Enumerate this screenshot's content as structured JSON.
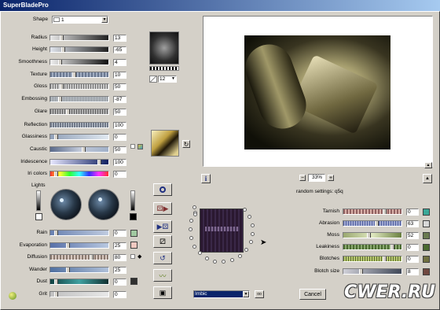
{
  "app": {
    "title": "SuperBladePro"
  },
  "shape": {
    "label": "Shape",
    "value": "1"
  },
  "left_sliders": [
    {
      "label": "Radius",
      "value": "13",
      "fill": "linear-gradient(90deg,#e8e8e8,#202020)"
    },
    {
      "label": "Height",
      "value": "-65",
      "fill": "linear-gradient(90deg,#e0e4ec,#202020)"
    },
    {
      "label": "Smoothness",
      "value": "4",
      "fill": "linear-gradient(90deg,#f0f0f0,#101010)"
    },
    {
      "label": "Texture",
      "value": "10",
      "fill": "repeating-linear-gradient(90deg,#6a7890 0 2px,#a0acc0 2px 4px)"
    },
    {
      "label": "Gloss",
      "value": "50",
      "fill": "repeating-linear-gradient(90deg,#707070 0 1px,#c8c8c8 1px 3px)"
    },
    {
      "label": "Embossing",
      "value": "-87",
      "fill": "repeating-linear-gradient(90deg,#808890 0 1px,#d0d4d8 1px 2px)"
    },
    {
      "label": "Glare",
      "value": "50",
      "fill": "repeating-linear-gradient(90deg,#606060 0 1px,#b0b0b0 1px 3px)"
    },
    {
      "label": "Reflection",
      "value": "100",
      "fill": "repeating-linear-gradient(90deg,#707888 0 2px,#c0c8d0 2px 3px)"
    },
    {
      "label": "Glassiness",
      "value": "0",
      "fill": "linear-gradient(90deg,#90a0b8,#e0e8f0)"
    },
    {
      "label": "Caustic",
      "value": "50",
      "fill": "linear-gradient(90deg,#5a6a8a,#c0c8d8,#a0b0c8)"
    },
    {
      "label": "Iridescence",
      "value": "100",
      "fill": "linear-gradient(90deg,#e8e8ff,#102060)"
    },
    {
      "label": "Iri colors",
      "value": "0",
      "fill": "linear-gradient(90deg,#ff3030,#ffff30,#30ff30,#30ffff,#3030ff,#ff30ff,#ff3030)"
    }
  ],
  "lights": {
    "label": "Lights"
  },
  "bottom_sliders": [
    {
      "label": "Rain",
      "value": "0",
      "fill": "linear-gradient(90deg,#6880b0,#c0cce0)"
    },
    {
      "label": "Evaporation",
      "value": "25",
      "fill": "linear-gradient(90deg,#5870a8,#b8c8e0)"
    },
    {
      "label": "Diffusion",
      "value": "80",
      "fill": "repeating-linear-gradient(90deg,#8a7a70 0 2px,#d8c8c0 2px 4px)"
    },
    {
      "label": "Wander",
      "value": "25",
      "fill": "linear-gradient(90deg,#5070a0,#b0c0d8)"
    },
    {
      "label": "Dust",
      "value": "0",
      "fill": "linear-gradient(90deg,#104040,#40a0a0,#103030)"
    },
    {
      "label": "Grit",
      "value": "0",
      "fill": "linear-gradient(90deg,#c0c0c0,#e8e8e8)"
    }
  ],
  "texture_number": "12",
  "zoom": {
    "value": "33%"
  },
  "random_settings": "random settings: q5q",
  "preset": {
    "value": "Imbic"
  },
  "right_sliders": [
    {
      "label": "Tarnish",
      "value": "0",
      "swatch": "#3aa898",
      "fill": "repeating-linear-gradient(90deg,#906060 0 2px,#d8b0a8 2px 4px)"
    },
    {
      "label": "Abrasion",
      "value": "63",
      "swatch": "#d8d8d8",
      "fill": "repeating-linear-gradient(90deg,#5060a0 0 1px,#a0a8d0 1px 3px)"
    },
    {
      "label": "Moss",
      "value": "52",
      "swatch": "#6a7a50",
      "fill": "linear-gradient(90deg,#9aa870,#e0e8c0,#6a8040)"
    },
    {
      "label": "Leakiness",
      "value": "0",
      "swatch": "#4a6a30",
      "fill": "repeating-linear-gradient(90deg,#4a6a30 0 2px,#8aa870 2px 4px)"
    },
    {
      "label": "Blotches",
      "value": "0",
      "swatch": "#707040",
      "fill": "repeating-linear-gradient(90deg,#5a6a30 0 1px,#b8c870 1px 3px)"
    },
    {
      "label": "Blotch size",
      "value": "8",
      "swatch": "#704840",
      "fill": "linear-gradient(90deg,#d0d0d8,#404858)"
    }
  ],
  "cancel_label": "Cancel",
  "watermark": "CWER.RU",
  "colors": {
    "accent": "#0a246a",
    "panel": "#d4d0c8"
  }
}
